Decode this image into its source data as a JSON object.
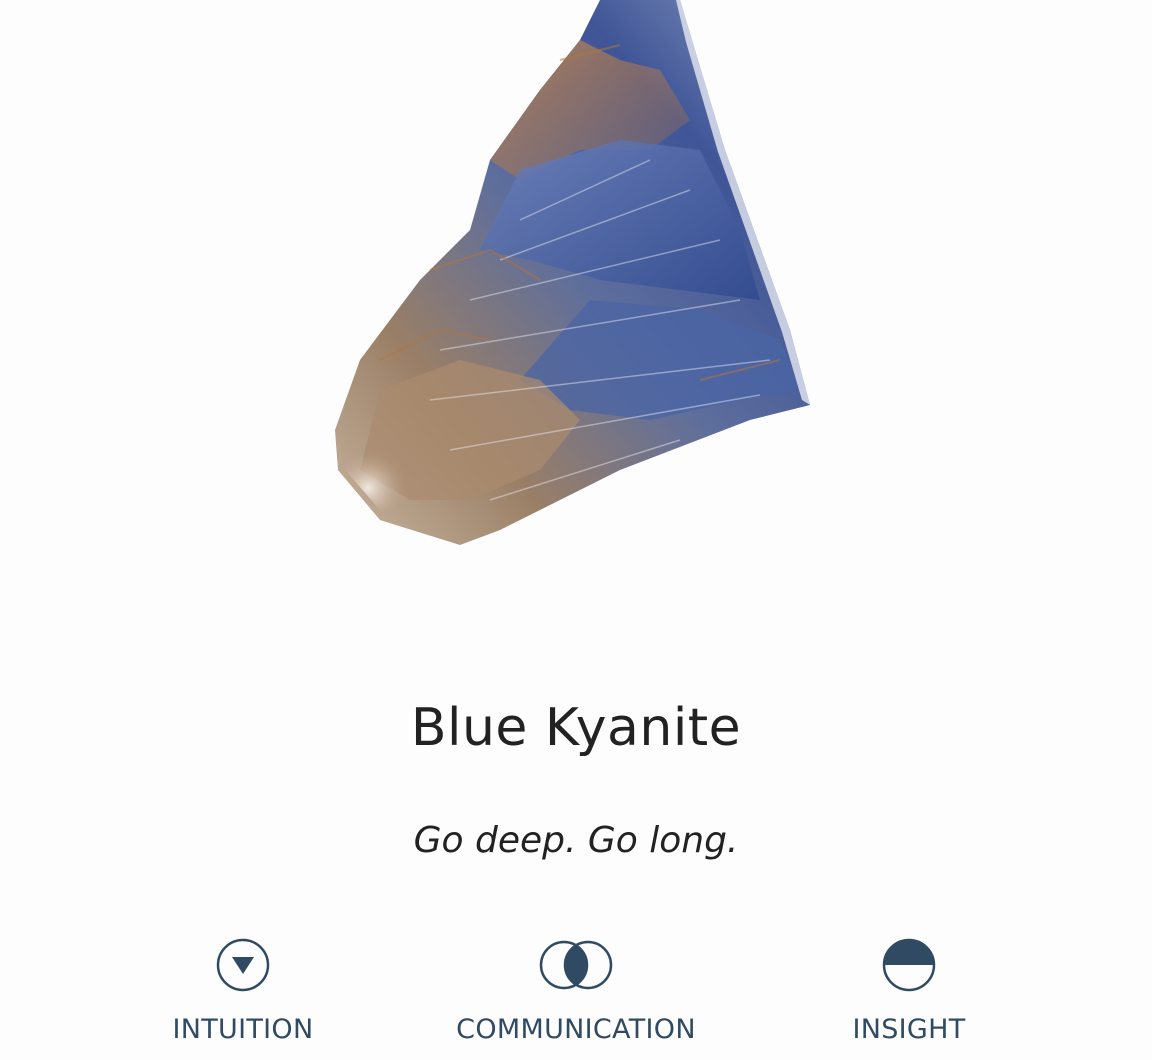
{
  "stone": {
    "name": "Blue Kyanite",
    "tagline": "Go deep. Go long."
  },
  "traits": [
    {
      "label": "INTUITION",
      "icon": "triangle-in-circle-icon"
    },
    {
      "label": "COMMUNICATION",
      "icon": "overlapping-circles-icon"
    },
    {
      "label": "INSIGHT",
      "icon": "half-filled-circle-icon"
    }
  ],
  "colors": {
    "background": "#fefdfd",
    "text": "#222222",
    "accent": "#2f4a62"
  }
}
